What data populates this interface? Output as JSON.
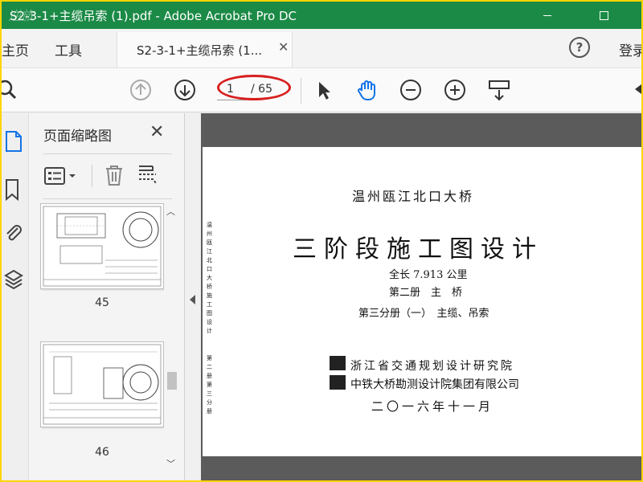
{
  "window": {
    "title": "S2-3-1+主缆吊索 (1).pdf - Adobe Acrobat Pro DC",
    "watermark": "逆旅"
  },
  "tabs": {
    "home": "主页",
    "tools": "工具",
    "document": "S2-3-1+主缆吊索 (1...",
    "help": "?",
    "login": "登录"
  },
  "toolbar": {
    "current_page": "1",
    "total_pages": "/ 65"
  },
  "thumbnails": {
    "title": "页面缩略图",
    "pages": [
      {
        "label": "45"
      },
      {
        "label": "46"
      }
    ]
  },
  "document": {
    "org": "温州瓯江北口大桥",
    "main_title": "三阶段施工图设计",
    "length": "全长 7.913 公里",
    "volume": "第二册　主　桥",
    "subvolume": "第三分册（一）　主缆、吊索",
    "institute1": "浙江省交通规划设计研究院",
    "institute2": "中铁大桥勘测设计院集团有限公司",
    "date": "二〇一六年十一月",
    "spine1": "温州瓯江北口大桥施工图设计",
    "spine2": "第二册第三分册"
  },
  "colors": {
    "titlebar": "#1b8a46",
    "accent_blue": "#1473e6",
    "highlight_red": "#d81e1e",
    "border_yellow": "#ffd400"
  }
}
